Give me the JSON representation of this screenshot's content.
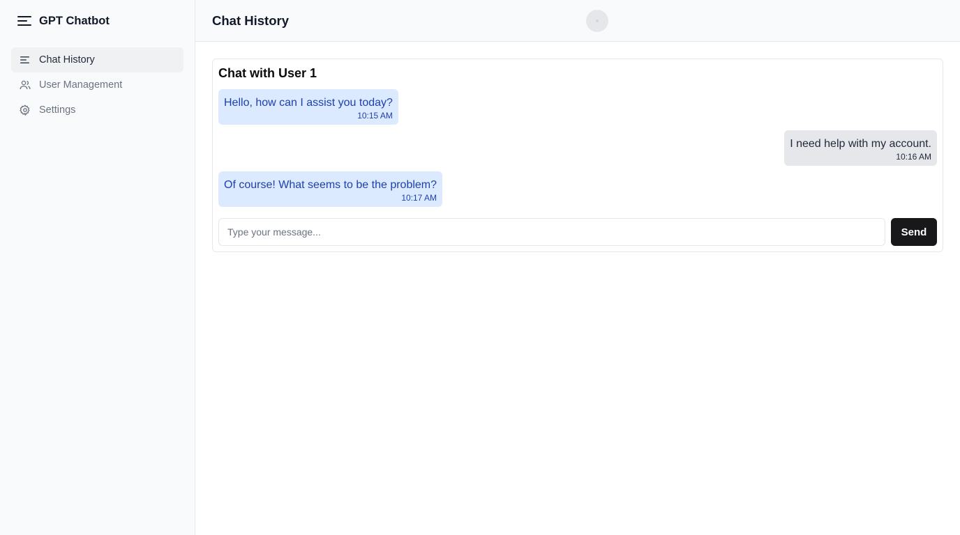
{
  "sidebar": {
    "brand": "GPT Chatbot",
    "brand_icon": "menu-icon",
    "items": [
      {
        "label": "Chat History",
        "icon": "list-icon",
        "active": true
      },
      {
        "label": "User Management",
        "icon": "users-icon",
        "active": false
      },
      {
        "label": "Settings",
        "icon": "gear-icon",
        "active": false
      }
    ]
  },
  "header": {
    "title": "Chat History"
  },
  "chat": {
    "title": "Chat with User 1",
    "messages": [
      {
        "sender": "bot",
        "text": "Hello, how can I assist you today?",
        "time": "10:15 AM"
      },
      {
        "sender": "user",
        "text": "I need help with my account.",
        "time": "10:16 AM"
      },
      {
        "sender": "bot",
        "text": "Of course! What seems to be the problem?",
        "time": "10:17 AM"
      }
    ],
    "input_placeholder": "Type your message...",
    "input_value": "",
    "send_label": "Send"
  },
  "colors": {
    "bot_bubble": "#dbeafe",
    "bot_text": "#1e40af",
    "user_bubble": "#e5e7eb",
    "send_button": "#18181b"
  }
}
